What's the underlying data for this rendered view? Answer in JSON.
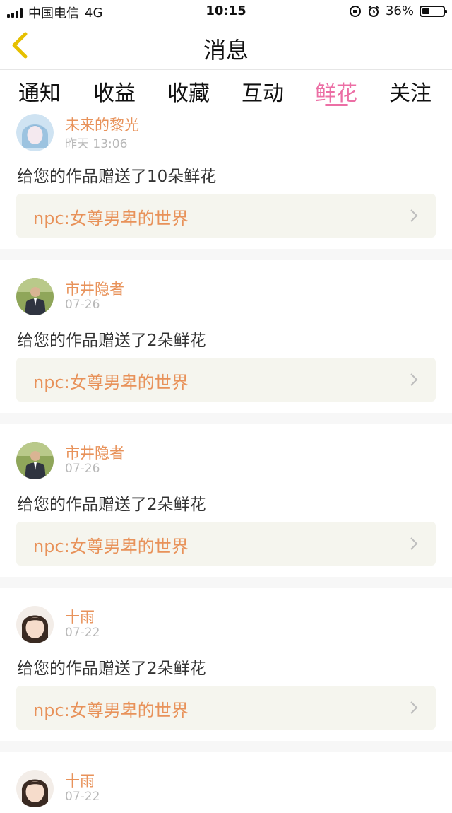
{
  "status_bar": {
    "carrier": "中国电信",
    "network": "4G",
    "time": "10:15",
    "battery_percent": "36%",
    "battery_level": 0.36
  },
  "header": {
    "title": "消息",
    "back_icon": "chevron-left-icon"
  },
  "tabs": [
    {
      "label": "通知",
      "active": false
    },
    {
      "label": "收益",
      "active": false
    },
    {
      "label": "收藏",
      "active": false
    },
    {
      "label": "互动",
      "active": false
    },
    {
      "label": "鲜花",
      "active": true
    },
    {
      "label": "关注",
      "active": false
    }
  ],
  "colors": {
    "accent_pink": "#ec6fa5",
    "name_orange": "#e8925a",
    "work_bg": "#f5f5ee"
  },
  "notifications": [
    {
      "user": "未来的黎光",
      "time": "昨天 13:06",
      "message": "给您的作品赠送了10朵鲜花",
      "work_title": "npc:女尊男卑的世界",
      "avatar": "anime-avatar"
    },
    {
      "user": "市井隐者",
      "time": "07-26",
      "message": "给您的作品赠送了2朵鲜花",
      "work_title": "npc:女尊男卑的世界",
      "avatar": "man-avatar"
    },
    {
      "user": "市井隐者",
      "time": "07-26",
      "message": "给您的作品赠送了2朵鲜花",
      "work_title": "npc:女尊男卑的世界",
      "avatar": "man-avatar"
    },
    {
      "user": "十雨",
      "time": "07-22",
      "message": "给您的作品赠送了2朵鲜花",
      "work_title": "npc:女尊男卑的世界",
      "avatar": "girl-avatar"
    },
    {
      "user": "十雨",
      "time": "07-22",
      "message": "",
      "work_title": "",
      "avatar": "girl-avatar"
    }
  ]
}
